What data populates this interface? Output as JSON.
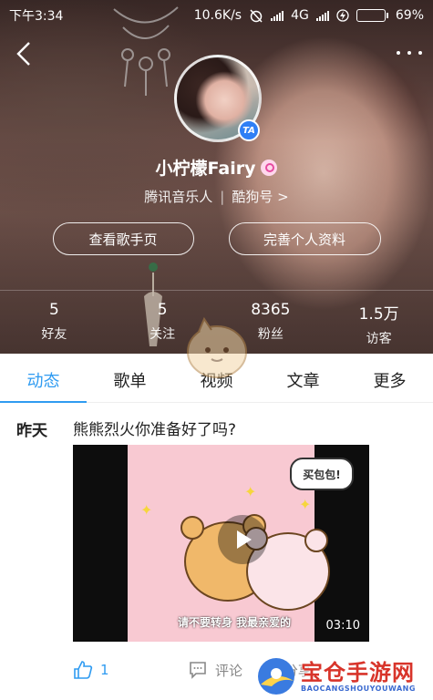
{
  "status_bar": {
    "time": "下午3:34",
    "net_speed": "10.6K/s",
    "network": "4G",
    "battery": "69%",
    "battery_level": 0.69
  },
  "profile": {
    "name": "小柠檬Fairy",
    "role": "腾讯音乐人",
    "kugou_link": "酷狗号 >",
    "buttons": {
      "view_singer_page": "查看歌手页",
      "complete_profile": "完善个人资料"
    },
    "stats": [
      {
        "value": "5",
        "label": "好友"
      },
      {
        "value": "5",
        "label": "关注"
      },
      {
        "value": "8365",
        "label": "粉丝"
      },
      {
        "value": "1.5万",
        "label": "访客"
      }
    ]
  },
  "tabs": [
    {
      "label": "动态",
      "active": true
    },
    {
      "label": "歌单",
      "active": false
    },
    {
      "label": "视频",
      "active": false
    },
    {
      "label": "文章",
      "active": false
    },
    {
      "label": "更多",
      "active": false
    }
  ],
  "post": {
    "date": "昨天",
    "title": "熊熊烈火你准备好了吗?",
    "video": {
      "bubble_text": "买包包!",
      "subtitle": "请不要转身 我最亲爱的",
      "duration": "03:10"
    },
    "likes": "1",
    "comment_label": "评论",
    "share_label_partial": "[分享"
  },
  "watermark": {
    "main": "宝仓手游网",
    "sub": "BAOCANGSHOUYOUWANG"
  },
  "colors": {
    "accent": "#2f9bf1",
    "battery_fill": "#36d44a",
    "watermark_red": "#d8342a"
  }
}
